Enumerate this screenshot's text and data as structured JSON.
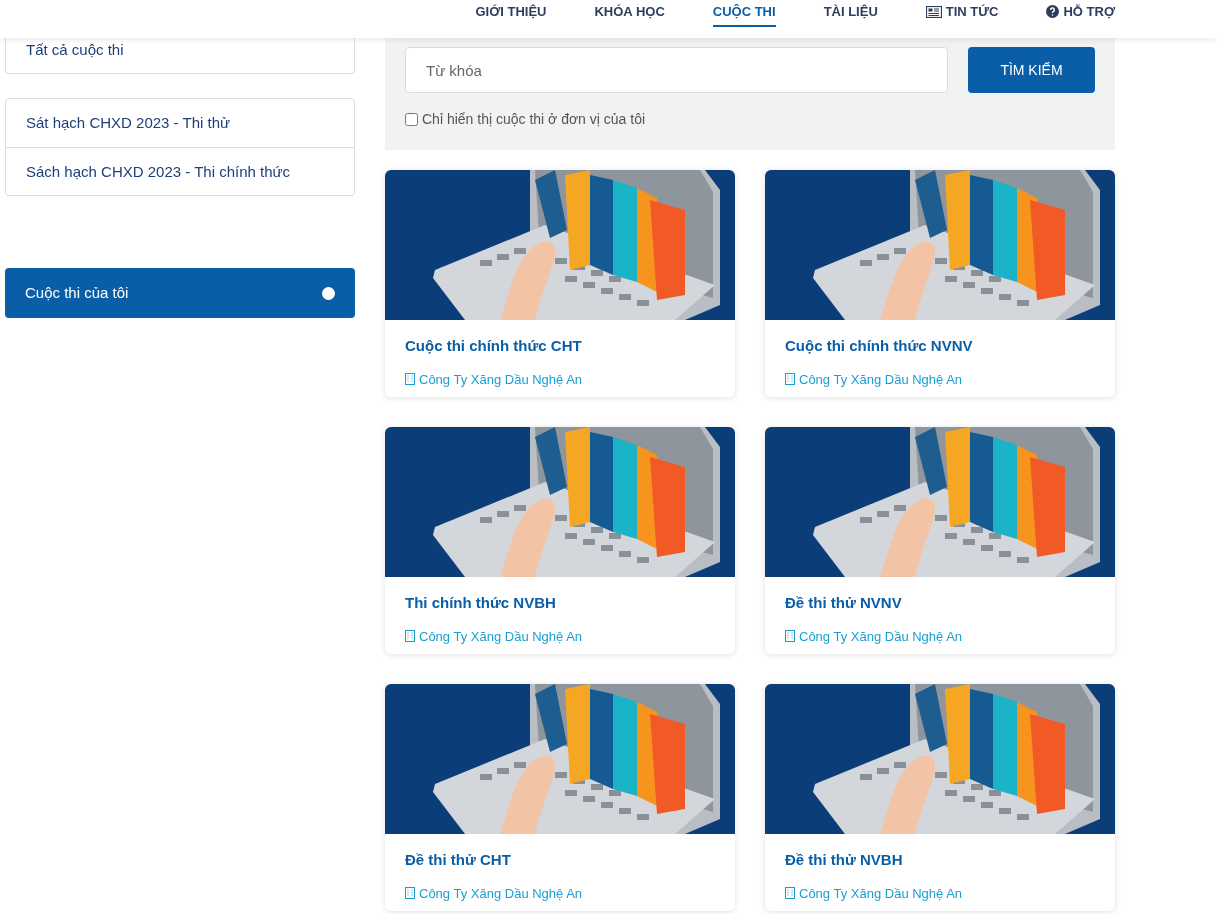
{
  "nav": [
    {
      "label": "GIỚI THIỆU",
      "selected": false,
      "kind": "text"
    },
    {
      "label": "KHÓA HỌC",
      "selected": false,
      "kind": "text"
    },
    {
      "label": "CUỘC THI",
      "selected": true,
      "kind": "text"
    },
    {
      "label": "TÀI LIỆU",
      "selected": false,
      "kind": "text"
    },
    {
      "label": "TIN TỨC",
      "selected": false,
      "kind": "news"
    },
    {
      "label": "HỖ TRỢ",
      "selected": false,
      "kind": "help"
    }
  ],
  "sidebar": {
    "all_link": "Tất cả cuộc thi",
    "groups": [
      "Sát hạch CHXD 2023 - Thi thử",
      "Sách hạch CHXD 2023 - Thi chính thức"
    ],
    "my_contests": "Cuộc thi của tôi"
  },
  "search": {
    "placeholder": "Từ khóa",
    "button": "TÌM KIẾM",
    "filter_label": "Chỉ hiển thị cuộc thi ở đơn vị của tôi",
    "filter_checked": false
  },
  "contests": [
    {
      "title": "Cuộc thi chính thức CHT",
      "unit": "Công Ty Xăng Dầu Nghệ An"
    },
    {
      "title": "Cuộc thi chính thức NVNV",
      "unit": "Công Ty Xăng Dầu Nghệ An"
    },
    {
      "title": "Thi chính thức NVBH",
      "unit": "Công Ty Xăng Dầu Nghệ An"
    },
    {
      "title": "Đề thi thử NVNV",
      "unit": "Công Ty Xăng Dầu Nghệ An"
    },
    {
      "title": "Đề thi thử CHT",
      "unit": "Công Ty Xăng Dầu Nghệ An"
    },
    {
      "title": "Đề thi thử NVBH",
      "unit": "Công Ty Xăng Dầu Nghệ An"
    }
  ]
}
